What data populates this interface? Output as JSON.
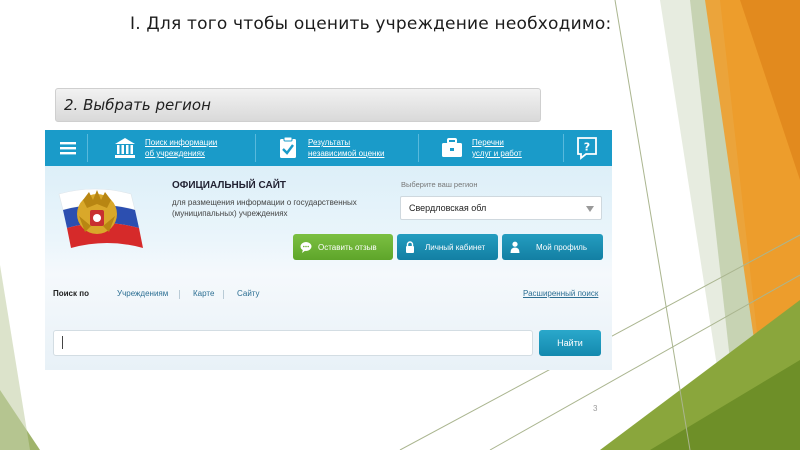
{
  "slide": {
    "title": "I. Для того чтобы оценить учреждение необходимо:",
    "subtitle": "2. Выбрать регион",
    "page_number": "3"
  },
  "site": {
    "nav": [
      {
        "icon": "hamburger-icon"
      },
      {
        "icon": "institution-building-icon",
        "line1": "Поиск информации",
        "line2": "об учреждениях"
      },
      {
        "icon": "clipboard-check-icon",
        "line1": "Результаты",
        "line2": "независимой оценки"
      },
      {
        "icon": "briefcase-icon",
        "line1": "Перечни",
        "line2": "услуг и работ"
      },
      {
        "icon": "help-question-icon"
      }
    ],
    "name": "ОФИЦИАЛЬНЫЙ САЙТ",
    "description": "для размещения информации о государственных (муниципальных) учреждениях",
    "region": {
      "label": "Выберите ваш регион",
      "selected": "Свердловская обл"
    },
    "buttons": {
      "feedback": "Оставить отзыв",
      "cabinet": "Личный кабинет",
      "profile": "Мой профиль"
    },
    "search_tabs": {
      "label": "Поиск по",
      "items": [
        "Учреждениям",
        "Карте",
        "Сайту"
      ],
      "advanced": "Расширенный поиск"
    },
    "search": {
      "value": "",
      "button": "Найти"
    }
  },
  "colors": {
    "nav_bg": "#1a9bc9",
    "green_button": "#6eb236",
    "teal_button": "#1a8db4",
    "deco_olive": "#8aa63c",
    "deco_orange": "#e28a1e"
  }
}
